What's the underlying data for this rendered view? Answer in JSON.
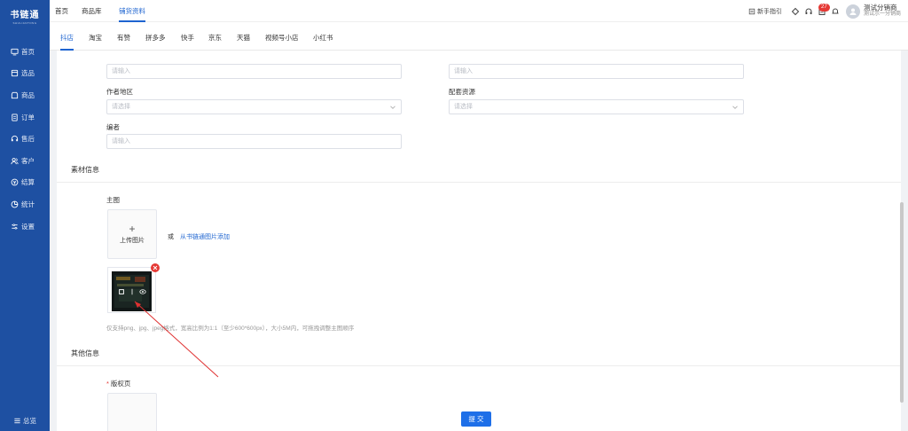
{
  "app": {
    "logo": "书链通",
    "logo_sub": "SHULIANTONG"
  },
  "sidebar": {
    "items": [
      {
        "label": "首页",
        "icon": "monitor-icon"
      },
      {
        "label": "选品",
        "icon": "box-icon"
      },
      {
        "label": "商品",
        "icon": "shop-icon"
      },
      {
        "label": "订单",
        "icon": "order-icon"
      },
      {
        "label": "售后",
        "icon": "headset-icon"
      },
      {
        "label": "客户",
        "icon": "users-icon"
      },
      {
        "label": "结算",
        "icon": "coin-icon"
      },
      {
        "label": "统计",
        "icon": "chart-icon"
      },
      {
        "label": "设置",
        "icon": "settings-icon"
      }
    ],
    "collapse_label": "总览"
  },
  "header": {
    "tabs": [
      "首页",
      "商品库",
      "铺货资料"
    ],
    "active_tab": "铺货资料",
    "guide": "新手指引",
    "notification_count": "27",
    "user_name": "测试分销商",
    "user_sub": "测试示一分销商"
  },
  "platform_tabs": [
    "抖店",
    "淘宝",
    "有赞",
    "拼多多",
    "快手",
    "京东",
    "天猫",
    "视频号小店",
    "小红书"
  ],
  "form": {
    "field1_placeholder": "请输入",
    "field2_placeholder": "请输入",
    "author_region_label": "作者地区",
    "author_region_placeholder": "请选择",
    "supporting_resources_label": "配套资源",
    "supporting_resources_placeholder": "请选择",
    "editor_label": "编者",
    "editor_placeholder": "请输入"
  },
  "material": {
    "section_title": "素材信息",
    "main_image_label": "主图",
    "upload_label": "上传图片",
    "or_text": "或",
    "from_library_link": "从书链通图片添加",
    "hint": "仅支持png、jpg、jpeg格式，宽高比例为1:1（至少600*600px），大小5M内，可拖拽调整主图顺序"
  },
  "other": {
    "section_title": "其他信息",
    "copyright_label": "版权页"
  },
  "actions": {
    "submit": "提 交"
  },
  "colors": {
    "sidebar": "#1e50a2",
    "accent": "#1e64d0",
    "danger": "#e53935"
  }
}
